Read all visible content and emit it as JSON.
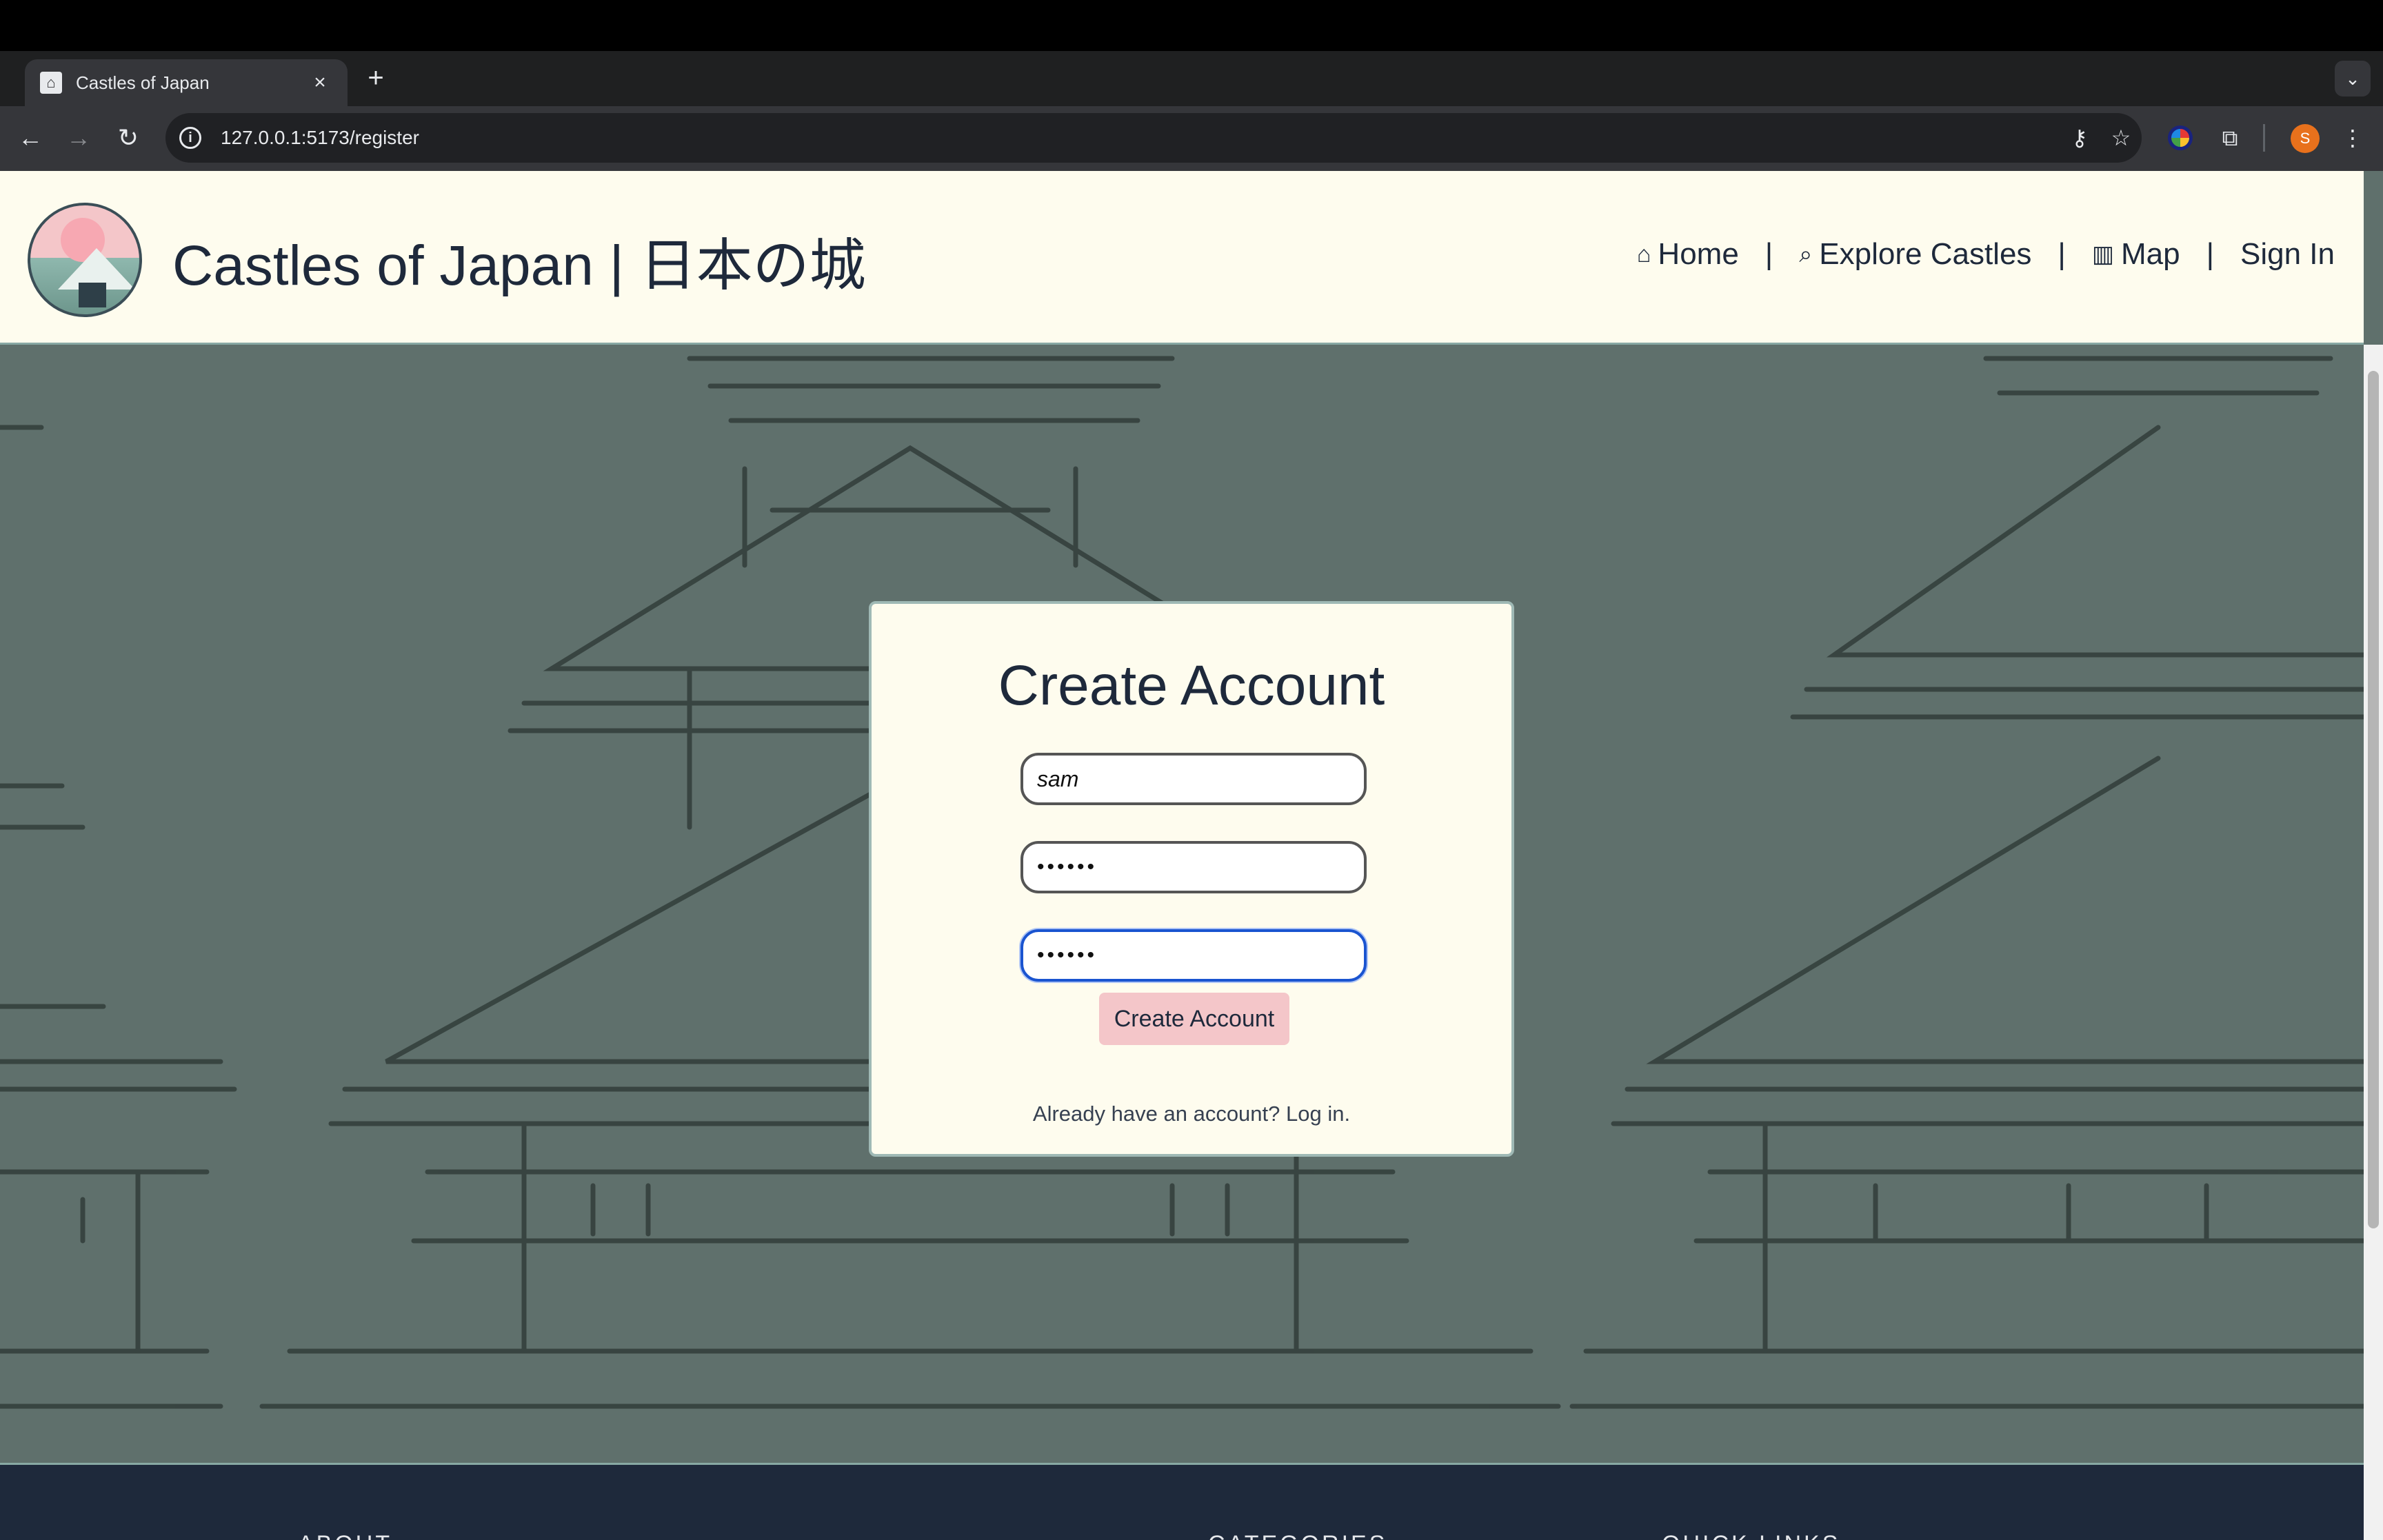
{
  "browser": {
    "tab_title": "Castles of Japan",
    "url": "127.0.0.1:5173/register",
    "profile_initial": "S"
  },
  "header": {
    "site_title": "Castles of Japan | 日本の城",
    "nav": {
      "home": "Home",
      "explore": "Explore Castles",
      "map": "Map",
      "sign_in": "Sign In",
      "separator": "|"
    }
  },
  "form": {
    "title": "Create Account",
    "username_value": "sam",
    "password_masked": "••••••",
    "confirm_masked": "••••••",
    "submit_label": "Create Account",
    "login_prompt": "Already have an account? Log in."
  },
  "footer": {
    "headings": [
      "ABOUT",
      "CATEGORIES",
      "QUICK LINKS"
    ]
  },
  "colors": {
    "header_bg": "#fefcee",
    "page_bg": "#5f706c",
    "sketch_stroke": "#34403d",
    "button_bg": "#f4c6c9",
    "footer_bg": "#1e293b",
    "focus_ring": "#1a54d0"
  }
}
